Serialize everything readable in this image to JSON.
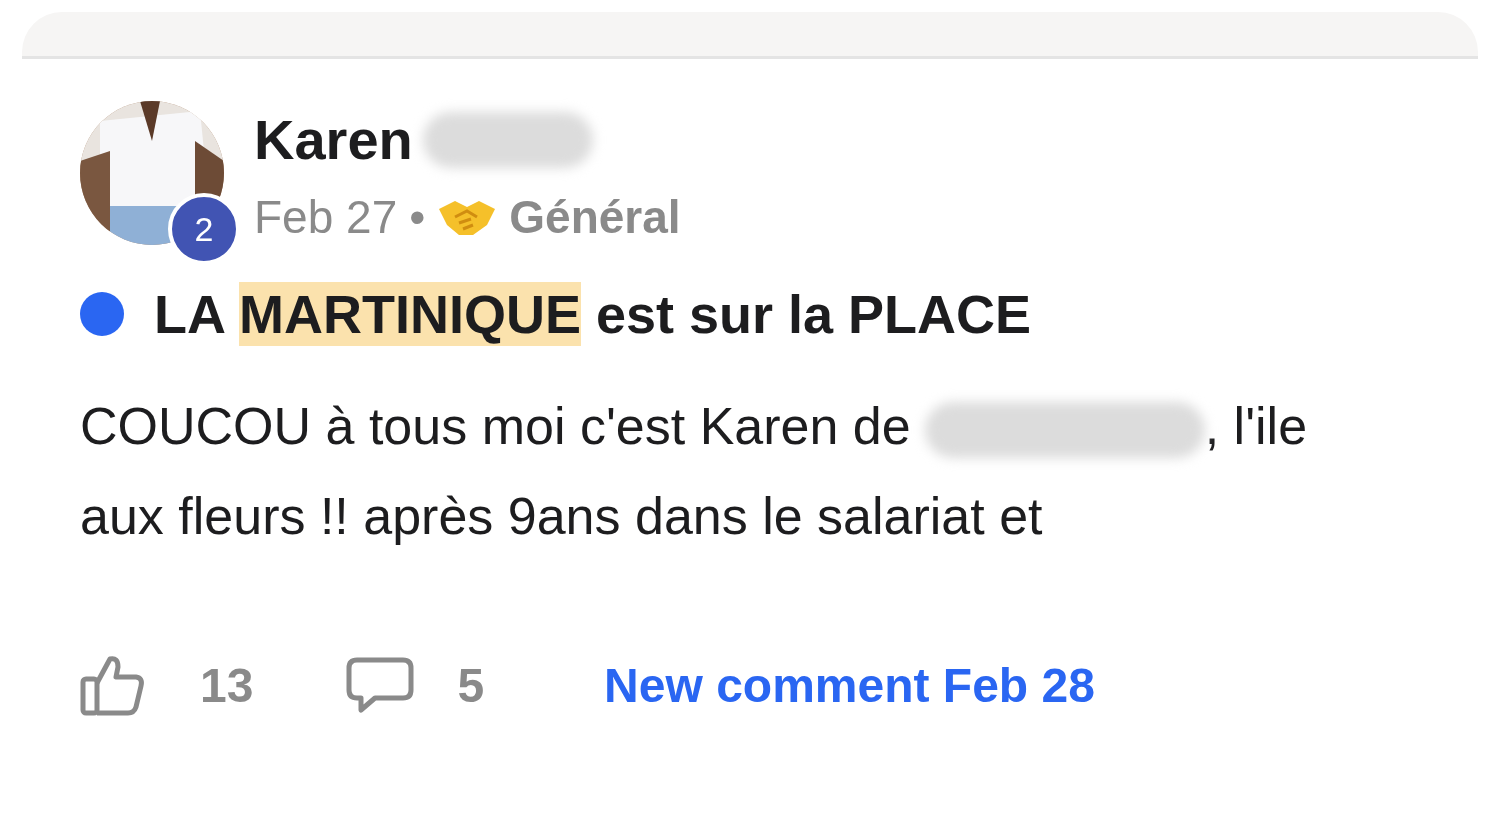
{
  "post": {
    "author": {
      "name": "Karen",
      "surname_redacted": true,
      "level_badge": "2"
    },
    "date": "Feb 27",
    "separator": "•",
    "category": "Général",
    "unread": true,
    "title": [
      {
        "text": "LA ",
        "highlighted": false
      },
      {
        "text": "MARTINIQUE",
        "highlighted": true
      },
      {
        "text": " est sur la PLACE",
        "highlighted": false
      }
    ],
    "body": [
      {
        "kind": "text",
        "text": "COUCOU à tous moi c'est Karen de"
      },
      {
        "kind": "redacted"
      },
      {
        "kind": "text",
        "text": ", l'ile aux fleurs !! après 9ans dans le salariat et"
      }
    ],
    "likes": "13",
    "comments": "5",
    "activity": "New comment Feb 28"
  }
}
